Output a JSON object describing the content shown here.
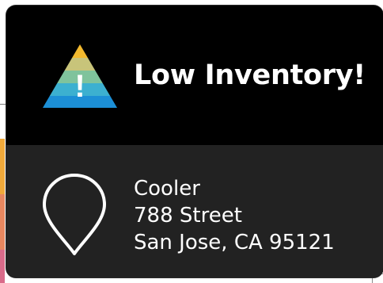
{
  "alert": {
    "title": "Low Inventory!",
    "icon": "warning-pyramid-icon",
    "icon_glyph": "!",
    "icon_colors": [
      "#f2b92e",
      "#c8c47a",
      "#7fc39c",
      "#3cb0d0",
      "#1c8fd6"
    ]
  },
  "location": {
    "icon": "map-pin-icon",
    "name": "Cooler",
    "street": "788 Street",
    "city_line": "San Jose, CA 95121"
  },
  "colors": {
    "header_bg": "#000000",
    "body_bg": "#222222",
    "text": "#ffffff",
    "bg_strips": [
      "#f0a93a",
      "#e8875f",
      "#d96b8a"
    ]
  }
}
